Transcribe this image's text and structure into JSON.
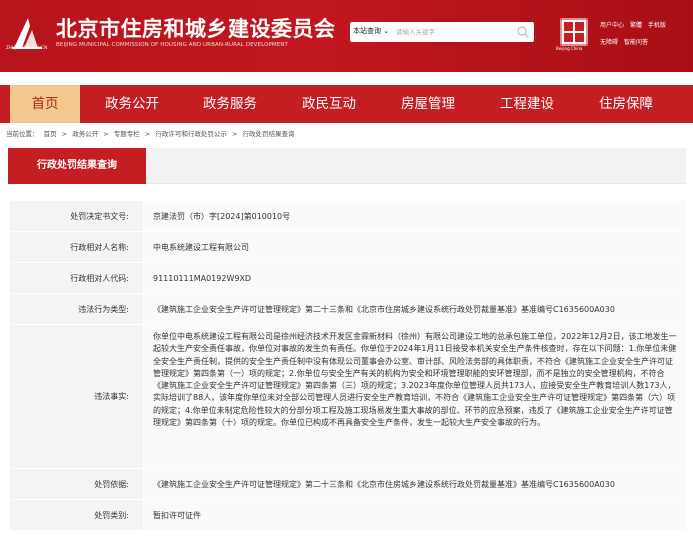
{
  "header": {
    "logo_sub": "ZHUJIANWEI.GOV.CN",
    "title": "北京市住房和城乡建设委员会",
    "title_en": "BEIJING MUNICIPAL COMMISSION OF HOUSING AND URBAN-RURAL DEVELOPMENT",
    "seal_label": "Beijing China",
    "utilities_row1": [
      "用户中心",
      "繁體",
      "手机版"
    ],
    "utilities_row2": [
      "无障碍",
      "智能问答"
    ],
    "colors": {
      "brand_red": "#c41d22",
      "active_tab": "#f2c88c"
    }
  },
  "search": {
    "scope_label": "本站查询",
    "placeholder": "请输入关键字"
  },
  "nav": {
    "items": [
      "首页",
      "政务公开",
      "政务服务",
      "政民互动",
      "房屋管理",
      "工程建设",
      "住房保障"
    ],
    "active_index": 0
  },
  "breadcrumb": {
    "prefix": "当前位置：",
    "path": [
      "首页",
      ">",
      "政务公开",
      ">",
      "专题专栏",
      ">",
      "行政许可和行政处罚公示",
      ">",
      "行政处罚结果查询"
    ]
  },
  "section": {
    "tab_label": "行政处罚结果查询"
  },
  "detail": {
    "rows": [
      {
        "label": "处罚决定书文号:",
        "value": "京建法罚（市）字[2024]第010010号"
      },
      {
        "label": "行政相对人名称:",
        "value": "中电系统建设工程有限公司"
      },
      {
        "label": "行政相对人代码:",
        "value": "91110111MA0192W9XD"
      },
      {
        "label": "违法行为类型:",
        "value": "《建筑施工企业安全生产许可证管理规定》第二十三条和《北京市住房城乡建设系统行政处罚裁量基准》基准编号C1635600A030"
      },
      {
        "label": "违法事实:",
        "value": "你单位中电系统建设工程有限公司是徐州经济技术开发区金霖新材料（徐州）有限公司建设工地的总承包施工单位，2022年12月2日，该工地发生一起较大生产安全责任事故，你单位对事故的发生负有责任。你单位于2024年1月11日接受本机关安全生产条件核查时，存在以下问题：1.你单位未健全安全生产责任制，提供的安全生产责任制中没有体现公司董事会办公室、审计部、风险法务部的具体职责，不符合《建筑施工企业安全生产许可证管理规定》第四条第（一）项的规定；2.你单位与安全生产有关的机构为安全和环境管理职能的安环管理部，而不是独立的安全管理机构，不符合《建筑施工企业安全生产许可证管理规定》第四条第（三）项的规定；3.2023年度你单位管理人员共173人，应接受安全生产教育培训人数173人，实际培训了88人，该年度你单位未对全部公司管理人员进行安全生产教育培训，不符合《建筑施工企业安全生产许可证管理规定》第四条第（六）项的规定；4.你单位未制定危险性较大的分部分项工程及施工现场易发生重大事故的部位、环节的应急预案，违反了《建筑施工企业安全生产许可证管理规定》第四条第（十）项的规定。你单位已构成不再具备安全生产条件，发生一起较大生产安全事故的行为。"
      },
      {
        "label": "处罚依据:",
        "value": "《建筑施工企业安全生产许可证管理规定》第二十三条和《北京市住房城乡建设系统行政处罚裁量基准》基准编号C1635600A030"
      },
      {
        "label": "处罚类别:",
        "value": "暂扣许可证件"
      }
    ]
  }
}
